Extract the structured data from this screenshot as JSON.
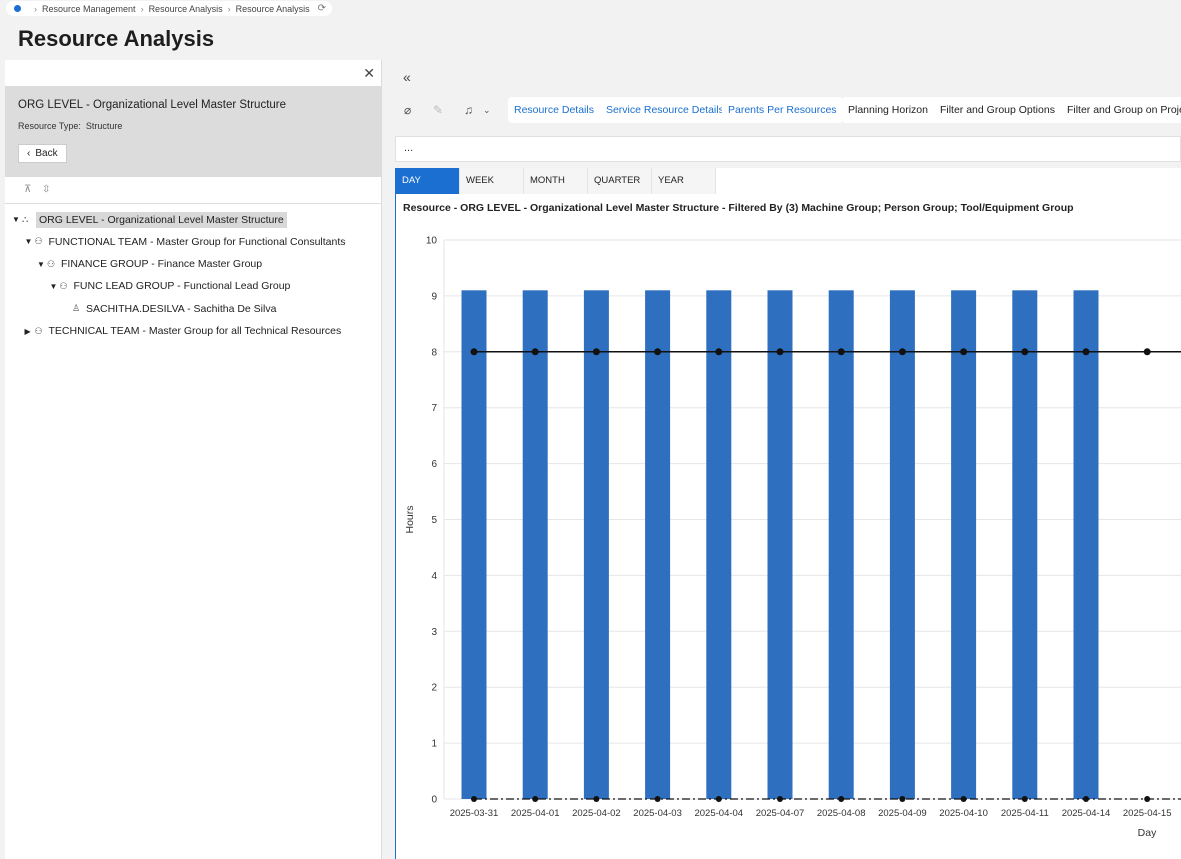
{
  "breadcrumb": [
    "Resource Management",
    "Resource Analysis",
    "Resource Analysis"
  ],
  "page_title": "Resource Analysis",
  "left_panel": {
    "header_title": "ORG LEVEL - Organizational Level Master Structure",
    "resource_type_label": "Resource Type:",
    "resource_type_value": "Structure",
    "back_label": "Back",
    "tree": [
      {
        "label": "ORG LEVEL - Organizational Level Master Structure",
        "level": 0,
        "expanded": true,
        "selected": true,
        "icon": "org-icon"
      },
      {
        "label": "FUNCTIONAL TEAM - Master Group for Functional Consultants",
        "level": 1,
        "expanded": true,
        "icon": "group-icon"
      },
      {
        "label": "FINANCE GROUP - Finance Master Group",
        "level": 2,
        "expanded": true,
        "icon": "group-icon"
      },
      {
        "label": "FUNC LEAD GROUP - Functional Lead Group",
        "level": 3,
        "expanded": true,
        "icon": "group-icon"
      },
      {
        "label": "SACHITHA.DESILVA - Sachitha De Silva",
        "level": 4,
        "leaf": true,
        "icon": "person-icon"
      },
      {
        "label": "TECHNICAL TEAM - Master Group for all Technical Resources",
        "level": 1,
        "expanded": false,
        "icon": "group-icon"
      }
    ]
  },
  "toolbar": {
    "links": [
      "Resource Details",
      "Service Resource Details",
      "Parents Per Resources"
    ],
    "actions": [
      "Planning Horizon",
      "Filter and Group Options",
      "Filter and Group on Project"
    ]
  },
  "criteria_text": "...",
  "tabs": [
    "DAY",
    "WEEK",
    "MONTH",
    "QUARTER",
    "YEAR"
  ],
  "active_tab": "DAY",
  "chart_data": {
    "type": "bar",
    "title": "Resource - ORG LEVEL - Organizational Level Master Structure - Filtered By (3) Machine Group; Person Group; Tool/Equipment Group",
    "xlabel": "Day",
    "ylabel": "Hours",
    "ylim": [
      0,
      10
    ],
    "yticks": [
      0,
      1,
      2,
      3,
      4,
      5,
      6,
      7,
      8,
      9,
      10
    ],
    "categories": [
      "2025-03-31",
      "2025-04-01",
      "2025-04-02",
      "2025-04-03",
      "2025-04-04",
      "2025-04-07",
      "2025-04-08",
      "2025-04-09",
      "2025-04-10",
      "2025-04-11",
      "2025-04-14",
      "2025-04-15"
    ],
    "series": [
      {
        "type": "bar",
        "color": "#2f6fbf",
        "values": [
          9.1,
          9.1,
          9.1,
          9.1,
          9.1,
          9.1,
          9.1,
          9.1,
          9.1,
          9.1,
          9.1,
          0
        ]
      },
      {
        "type": "line",
        "color": "#111111",
        "values": [
          8,
          8,
          8,
          8,
          8,
          8,
          8,
          8,
          8,
          8,
          8,
          8
        ]
      },
      {
        "type": "line",
        "color": "#111111",
        "dashed": true,
        "values": [
          0,
          0,
          0,
          0,
          0,
          0,
          0,
          0,
          0,
          0,
          0,
          0
        ]
      }
    ],
    "grid": true
  }
}
